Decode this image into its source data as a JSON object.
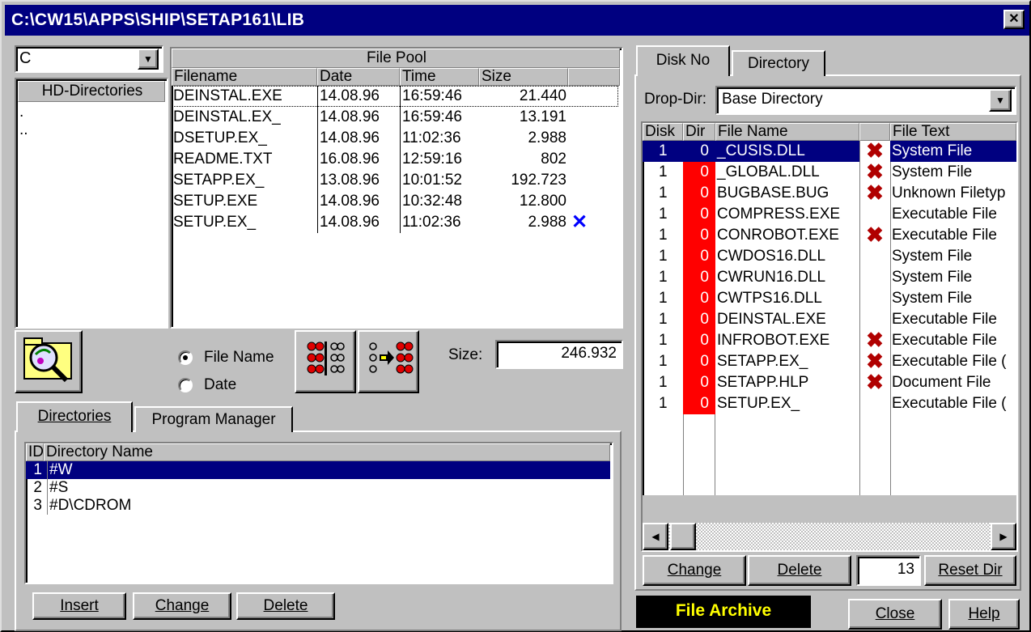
{
  "window": {
    "title": "C:\\CW15\\APPS\\SHIP\\SETAP161\\LIB",
    "close_glyph": "✕"
  },
  "drive": {
    "value": "C"
  },
  "hd_directories": {
    "header": "HD-Directories",
    "items": [
      ".",
      ".."
    ]
  },
  "file_pool": {
    "title": "File Pool",
    "columns": [
      "Filename",
      "Date",
      "Time",
      "Size"
    ],
    "rows": [
      {
        "name": "DEINSTAL.EXE",
        "date": "14.08.96",
        "time": "16:59:46",
        "size": "21.440",
        "mark": ""
      },
      {
        "name": "DEINSTAL.EX_",
        "date": "14.08.96",
        "time": "16:59:46",
        "size": "13.191",
        "mark": ""
      },
      {
        "name": "DSETUP.EX_",
        "date": "14.08.96",
        "time": "11:02:36",
        "size": "2.988",
        "mark": ""
      },
      {
        "name": "README.TXT",
        "date": "16.08.96",
        "time": "12:59:16",
        "size": "802",
        "mark": ""
      },
      {
        "name": "SETAPP.EX_",
        "date": "13.08.96",
        "time": "10:01:52",
        "size": "192.723",
        "mark": ""
      },
      {
        "name": "SETUP.EXE",
        "date": "14.08.96",
        "time": "10:32:48",
        "size": "12.800",
        "mark": ""
      },
      {
        "name": "SETUP.EX_",
        "date": "14.08.96",
        "time": "11:02:36",
        "size": "2.988",
        "mark": "✕"
      }
    ]
  },
  "sort": {
    "options": [
      "File Name",
      "Date"
    ],
    "selected": "File Name"
  },
  "size": {
    "label": "Size:",
    "value": "246.932"
  },
  "left_tabs": [
    "Directories",
    "Program Manager"
  ],
  "directories": {
    "columns": [
      "ID",
      "Directory Name"
    ],
    "rows": [
      {
        "id": "1",
        "name": "#W"
      },
      {
        "id": "2",
        "name": "#S"
      },
      {
        "id": "3",
        "name": "#D\\CDROM"
      }
    ],
    "buttons": [
      "Insert",
      "Change",
      "Delete"
    ]
  },
  "right_tabs": [
    "Disk No",
    "Directory"
  ],
  "drop_dir": {
    "label": "Drop-Dir:",
    "value": "Base Directory"
  },
  "disk_list": {
    "columns": [
      "Disk",
      "Dir",
      "File Name",
      "",
      "File Text"
    ],
    "rows": [
      {
        "disk": "1",
        "dir": "0",
        "name": "_CUSIS.DLL",
        "x": true,
        "text": "System File"
      },
      {
        "disk": "1",
        "dir": "0",
        "name": "_GLOBAL.DLL",
        "x": true,
        "text": "System File"
      },
      {
        "disk": "1",
        "dir": "0",
        "name": "BUGBASE.BUG",
        "x": true,
        "text": "Unknown Filetyp"
      },
      {
        "disk": "1",
        "dir": "0",
        "name": "COMPRESS.EXE",
        "x": false,
        "text": "Executable File"
      },
      {
        "disk": "1",
        "dir": "0",
        "name": "CONROBOT.EXE",
        "x": true,
        "text": "Executable File"
      },
      {
        "disk": "1",
        "dir": "0",
        "name": "CWDOS16.DLL",
        "x": false,
        "text": "System File"
      },
      {
        "disk": "1",
        "dir": "0",
        "name": "CWRUN16.DLL",
        "x": false,
        "text": "System File"
      },
      {
        "disk": "1",
        "dir": "0",
        "name": "CWTPS16.DLL",
        "x": false,
        "text": "System File"
      },
      {
        "disk": "1",
        "dir": "0",
        "name": "DEINSTAL.EXE",
        "x": false,
        "text": "Executable File"
      },
      {
        "disk": "1",
        "dir": "0",
        "name": "INFROBOT.EXE",
        "x": true,
        "text": "Executable File"
      },
      {
        "disk": "1",
        "dir": "0",
        "name": "SETAPP.EX_",
        "x": true,
        "text": "Executable File ("
      },
      {
        "disk": "1",
        "dir": "0",
        "name": "SETAPP.HLP",
        "x": true,
        "text": "Document File"
      },
      {
        "disk": "1",
        "dir": "0",
        "name": "SETUP.EX_",
        "x": false,
        "text": "Executable File ("
      }
    ],
    "x_glyph": "✖"
  },
  "disk_buttons": {
    "change": "Change",
    "delete": "Delete",
    "count": "13",
    "reset": "Reset Dir"
  },
  "status": {
    "archive": "File Archive"
  },
  "footer": {
    "close": "Close",
    "help": "Help"
  },
  "colors": {
    "title_bar": "#000080",
    "selection": "#000080",
    "dir_column": "#ff0000",
    "archive_bg": "#000000",
    "archive_fg": "#ffff00",
    "x_mark": "#b00000",
    "check_mark": "#0000ff"
  }
}
